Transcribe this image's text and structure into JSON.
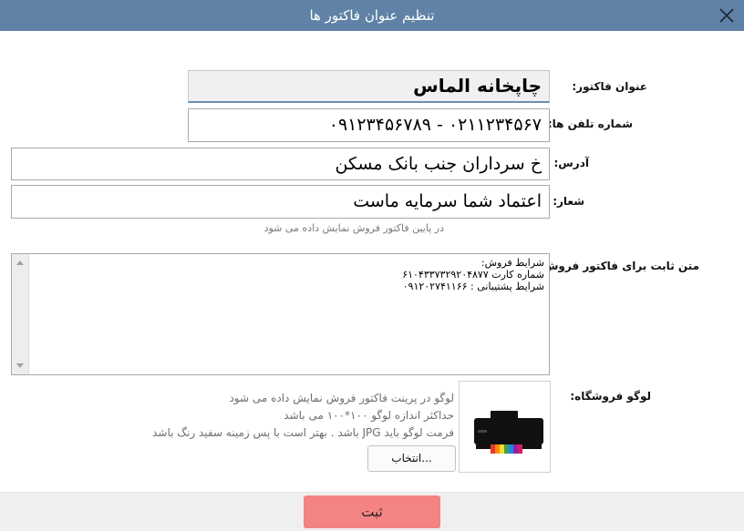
{
  "window": {
    "title": "تنظیم عنوان فاکتور ها"
  },
  "form": {
    "invoice_title": {
      "label": "عنوان فاکتور:",
      "value": "چاپخانه الماس"
    },
    "phones": {
      "label": "شماره تلفن ها:",
      "value": "۰۲۱۱۲۳۴۵۶۷ - ۰۹۱۲۳۴۵۶۷۸۹"
    },
    "address": {
      "label": "آدرس:",
      "value": "خ سرداران جنب بانک مسکن"
    },
    "slogan": {
      "label": "شعار:",
      "value": "اعتماد شما سرمایه ماست",
      "hint": "در پایین فاکتور فروش نمایش داده می شود"
    },
    "fixed_text": {
      "label": "متن ثابت برای فاکتور فروش:",
      "lines": [
        "شرایط فروش:",
        "شماره کارت ۶۱۰۴۳۳۷۳۲۹۲۰۴۸۷۷",
        "شرایط پشتیبانی : ۰۹۱۲۰۲۷۴۱۱۶۶"
      ]
    },
    "logo": {
      "label": "لوگو فروشگاه:",
      "notes": [
        "لوگو در پرینت فاکتور فروش نمایش داده می شود",
        "حداکثر اندازه لوگو ۱۰۰*۱۰۰ می باشد",
        "فرمت لوگو باید JPG باشد . بهتر است با پس زمینه سفید رنگ باشد"
      ],
      "choose_label": "انتخاب...",
      "icon": "printer-icon"
    }
  },
  "footer": {
    "submit_label": "ثبت"
  },
  "colors": {
    "titlebar": "#5f82a6",
    "submit": "#f48383"
  }
}
